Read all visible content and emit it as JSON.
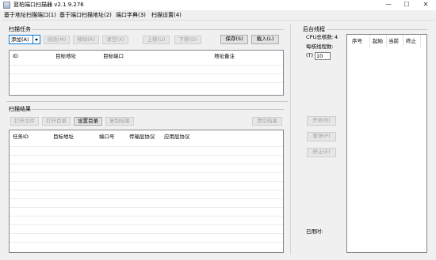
{
  "window": {
    "title": "篮柏端口扫描器 v2.1.9.276",
    "minimize": "—",
    "maximize": "☐",
    "close": "✕"
  },
  "tabs": [
    {
      "label": "基于地址扫描端口(1)",
      "active": true
    },
    {
      "label": "基于端口扫描地址(2)",
      "active": false
    },
    {
      "label": "端口字典(3)",
      "active": false
    },
    {
      "label": "扫描设置(4)",
      "active": false
    }
  ],
  "scan_task": {
    "group_label": "扫描任务",
    "add_label": "添加(A)",
    "modify_label": "修改(M)",
    "remove_label": "移除(R)",
    "clear_label": "清空(X)",
    "up_label": "上移(U)",
    "down_label": "下移(D)",
    "save_label": "保存(S)",
    "load_label": "载入(L)",
    "columns": [
      "ID",
      "目标地址",
      "目标端口",
      "地址备注"
    ]
  },
  "scan_result": {
    "group_label": "扫描结果",
    "open_file_label": "打开文件",
    "open_dir_label": "打开目录",
    "set_dir_label": "设置目录",
    "copy_result_label": "复制结果",
    "clear_result_label": "清空结果",
    "columns": [
      "任务ID",
      "目标地址",
      "端口号",
      "传输层协议",
      "应用层协议"
    ]
  },
  "threads": {
    "group_label": "后台线程",
    "cpu_label": "CPU总核数:",
    "cpu_value": "4",
    "per_core_label": "每核线程数:",
    "per_core_key": "(T)",
    "per_core_value": "10",
    "start_label": "开始(B)",
    "pause_label": "暂停(P)",
    "stop_label": "停止(E)",
    "elapsed_label": "已用时:",
    "columns": [
      "序号",
      "起始",
      "当前",
      "终止"
    ]
  }
}
